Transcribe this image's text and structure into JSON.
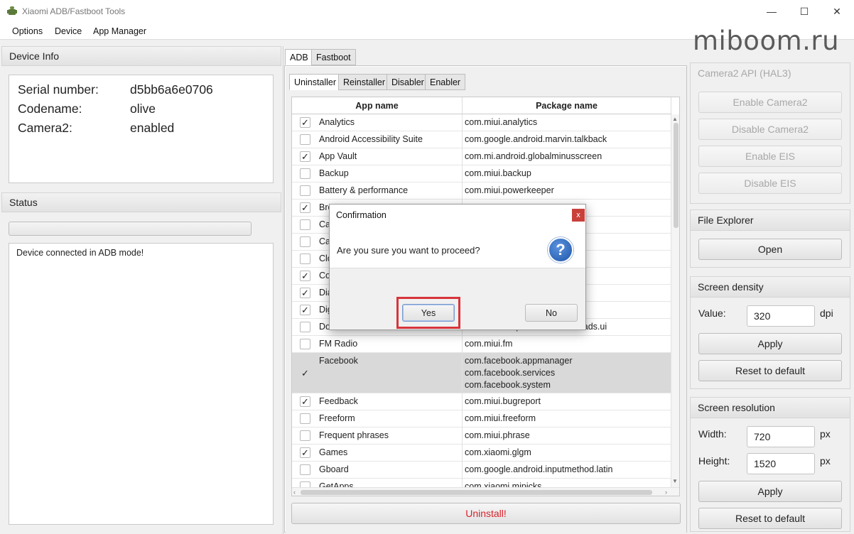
{
  "window": {
    "title": "Xiaomi ADB/Fastboot Tools",
    "minimize": "—",
    "maximize": "☐",
    "close": "✕"
  },
  "menu": [
    "Options",
    "Device",
    "App Manager"
  ],
  "watermark": "miboom.ru",
  "device_info": {
    "title": "Device Info",
    "rows": [
      {
        "label": "Serial number:",
        "value": "d5bb6a6e0706"
      },
      {
        "label": "Codename:",
        "value": "olive"
      },
      {
        "label": "Camera2:",
        "value": "enabled"
      }
    ]
  },
  "status": {
    "title": "Status",
    "progress": 0,
    "log": "Device connected in ADB mode!"
  },
  "main_tabs": [
    "ADB",
    "Fastboot"
  ],
  "sub_tabs": [
    "Uninstaller",
    "Reinstaller",
    "Disabler",
    "Enabler"
  ],
  "table": {
    "headers": [
      "App name",
      "Package name"
    ],
    "rows": [
      {
        "checked": true,
        "name": "Analytics",
        "pkg": "com.miui.analytics"
      },
      {
        "checked": false,
        "name": "Android Accessibility Suite",
        "pkg": "com.google.android.marvin.talkback"
      },
      {
        "checked": true,
        "name": "App Vault",
        "pkg": "com.mi.android.globalminusscreen"
      },
      {
        "checked": false,
        "name": "Backup",
        "pkg": "com.miui.backup"
      },
      {
        "checked": false,
        "name": "Battery & performance",
        "pkg": "com.miui.powerkeeper"
      },
      {
        "checked": true,
        "name": "Bro",
        "pkg": ""
      },
      {
        "checked": false,
        "name": "Ca",
        "pkg": ""
      },
      {
        "checked": false,
        "name": "Ca",
        "pkg": ""
      },
      {
        "checked": false,
        "name": "Clo",
        "pkg": ""
      },
      {
        "checked": true,
        "name": "Co",
        "pkg": ""
      },
      {
        "checked": true,
        "name": "Dia",
        "pkg": ""
      },
      {
        "checked": true,
        "name": "Dig",
        "pkg": "ing"
      },
      {
        "checked": false,
        "name": "Downloads",
        "pkg": "com.android.providers.downloads.ui"
      },
      {
        "checked": false,
        "name": "FM Radio",
        "pkg": "com.miui.fm"
      },
      {
        "checked": true,
        "name": "Facebook",
        "pkg": "com.facebook.appmanager\ncom.facebook.services\ncom.facebook.system"
      },
      {
        "checked": true,
        "name": "Feedback",
        "pkg": "com.miui.bugreport"
      },
      {
        "checked": false,
        "name": "Freeform",
        "pkg": "com.miui.freeform"
      },
      {
        "checked": false,
        "name": "Frequent phrases",
        "pkg": "com.miui.phrase"
      },
      {
        "checked": true,
        "name": "Games",
        "pkg": "com.xiaomi.glgm"
      },
      {
        "checked": false,
        "name": "Gboard",
        "pkg": "com.google.android.inputmethod.latin"
      },
      {
        "checked": false,
        "name": "GetApps",
        "pkg": "com.xiaomi.mipicks"
      }
    ]
  },
  "uninstall_button": "Uninstall!",
  "camera2": {
    "title": "Camera2 API (HAL3)",
    "buttons": [
      "Enable Camera2",
      "Disable Camera2",
      "Enable EIS",
      "Disable EIS"
    ]
  },
  "file_explorer": {
    "title": "File Explorer",
    "open": "Open"
  },
  "density": {
    "title": "Screen density",
    "label": "Value:",
    "value": "320",
    "unit": "dpi",
    "apply": "Apply",
    "reset": "Reset to default"
  },
  "resolution": {
    "title": "Screen resolution",
    "width_label": "Width:",
    "width": "720",
    "height_label": "Height:",
    "height": "1520",
    "unit": "px",
    "apply": "Apply",
    "reset": "Reset to default"
  },
  "dialog": {
    "title": "Confirmation",
    "message": "Are you sure you want to proceed?",
    "yes": "Yes",
    "no": "No",
    "close": "x",
    "icon": "?"
  },
  "colors": {
    "highlight": "#d8343b",
    "uninstall_text": "#d8222b",
    "dialog_icon": "#2a64b8"
  }
}
